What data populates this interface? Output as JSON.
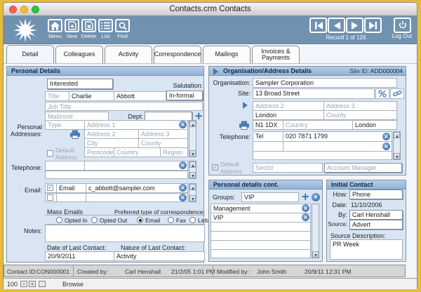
{
  "window": {
    "title": "Contacts.crm Contacts"
  },
  "toolbar": {
    "menu": "Menu",
    "new": "New",
    "delete": "Delete",
    "list": "List",
    "find": "Find",
    "record_status": "Record 1 of 126",
    "logout": "Log Out"
  },
  "tabs": [
    "Detail",
    "Colleagues",
    "Activity",
    "Correspondence",
    "Mailings",
    "Invoices & Payments"
  ],
  "personal": {
    "header": "Personal Details",
    "interested": "Interested",
    "salutation_label": "Salutation:",
    "title_ph": "Title",
    "first_name": "Charlie",
    "last_name": "Abbott",
    "salutation": "In-formal",
    "job_title_ph": "Job Title",
    "mailzone_ph": "Mailzone",
    "dept_label": "Dept:",
    "addresses_label": "Personal Addresses:",
    "type_ph": "Type",
    "address1_ph": "Address 1",
    "address2_ph": "Address 2",
    "address3_ph": "Address 3",
    "city_ph": "City",
    "county_ph": "County",
    "default_address_label": "Default Address",
    "postcode_ph": "Postcode",
    "country_ph": "Country",
    "region_ph": "Region",
    "telephone_label": "Telephone:",
    "email_label": "Email:",
    "email_type": "Email",
    "email_value": "c_abbott@sampler.com",
    "mass_emails_label": "Mass Emails",
    "opted_in": "Opted In",
    "opted_out": "Opted Out",
    "pref_label": "Preferred type of correspondence:",
    "pref_email": "Email",
    "pref_fax": "Fax",
    "pref_letter": "Letter",
    "notes_label": "Notes:",
    "date_last_label": "Date of Last Contact:",
    "date_last": "20/9/2011",
    "nature_last_label": "Nature of Last Contact:",
    "nature_last": "Activity"
  },
  "organisation": {
    "header": "Organisation/Address Details",
    "site_id_label": "Site ID:",
    "site_id": "ADD000004",
    "organisation_label": "Organisation:",
    "organisation": "Sampler Corporation",
    "site_label": "Site:",
    "site": "13 Broad Street",
    "address2_ph": "Address 2",
    "address3_ph": "Address 3",
    "city": "London",
    "county_ph": "County",
    "postcode": "N1 1DX",
    "country_ph": "Country",
    "region": "London",
    "telephone_label": "Telephone:",
    "tel_type": "Tel",
    "tel_number": "020 7871 1799",
    "default_address_label": "Default Address",
    "sector_ph": "Sector",
    "account_manager_ph": "Account Manager"
  },
  "personal_cont": {
    "header": "Personal details cont.",
    "groups_label": "Groups:",
    "groups_value": "VIP",
    "groups": [
      "Management",
      "VIP"
    ]
  },
  "initial_contact": {
    "header": "Initial Contact",
    "how_label": "How:",
    "how": "Phone",
    "date_label": "Date:",
    "date": "11/10/2006",
    "by_label": "By:",
    "by": "Carl Henshall",
    "source_label": "Source:",
    "source": "Advert",
    "source_desc_label": "Source Description:",
    "source_desc": "PR Week"
  },
  "statusbar": {
    "contact_id_label": "Contact ID:",
    "contact_id": "CON000001",
    "created_by_label": "Created by:",
    "created_by": "Carl Henshall",
    "created_at": "21/2/05 1:01 PM",
    "modified_by_label": "Modified by:",
    "modified_by": "John Smith",
    "modified_at": "20/9/11 12:31 PM"
  },
  "bottombar": {
    "zoom_level": "100",
    "mode": "Browse"
  },
  "colors": {
    "toolbar": "#7191b0",
    "frame": "#e7bd37",
    "accent": "#2e6cb3",
    "panel_bg": "#d9e5f3"
  }
}
